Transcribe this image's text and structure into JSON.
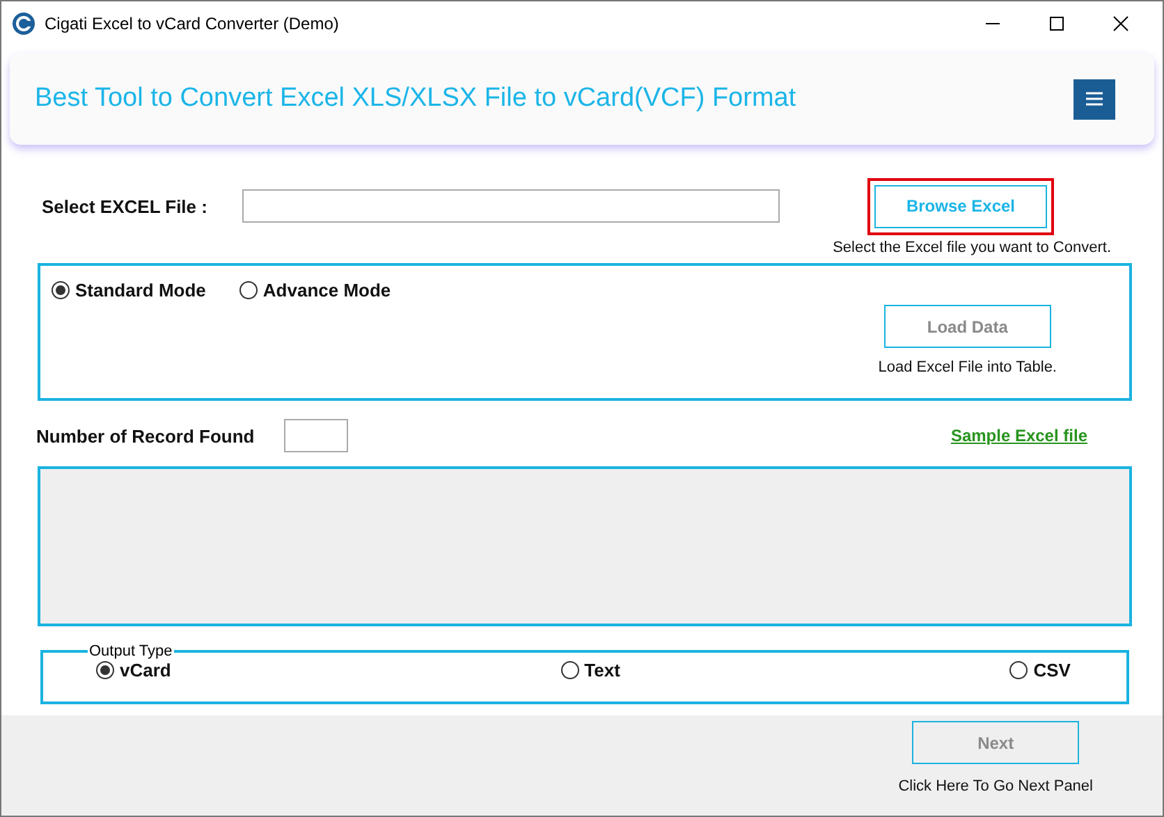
{
  "window": {
    "title": "Cigati Excel to vCard Converter (Demo)"
  },
  "header": {
    "title": "Best Tool to Convert Excel XLS/XLSX File to vCard(VCF) Format"
  },
  "file_select": {
    "label": "Select EXCEL File :",
    "browse_button": {
      "label": "Browse Excel",
      "focused": true
    },
    "hint": "Select the Excel file you want to Convert."
  },
  "modes": [
    {
      "label": "Standard Mode",
      "selected": true
    },
    {
      "label": "Advance Mode",
      "selected": false
    }
  ],
  "load_button": {
    "label": "Load Data",
    "disabled": true
  },
  "load_hint": "Load Excel File into Table.",
  "records": {
    "label": "Number of Record Found"
  },
  "sample_link": "Sample Excel file",
  "output_type": {
    "legend": "Output Type",
    "options": [
      {
        "label": "vCard",
        "selected": true
      },
      {
        "label": "Text",
        "selected": false
      },
      {
        "label": "CSV",
        "selected": false
      }
    ]
  },
  "next_button": {
    "label": "Next",
    "disabled": true
  },
  "next_hint": "Click Here To Go Next Panel"
}
